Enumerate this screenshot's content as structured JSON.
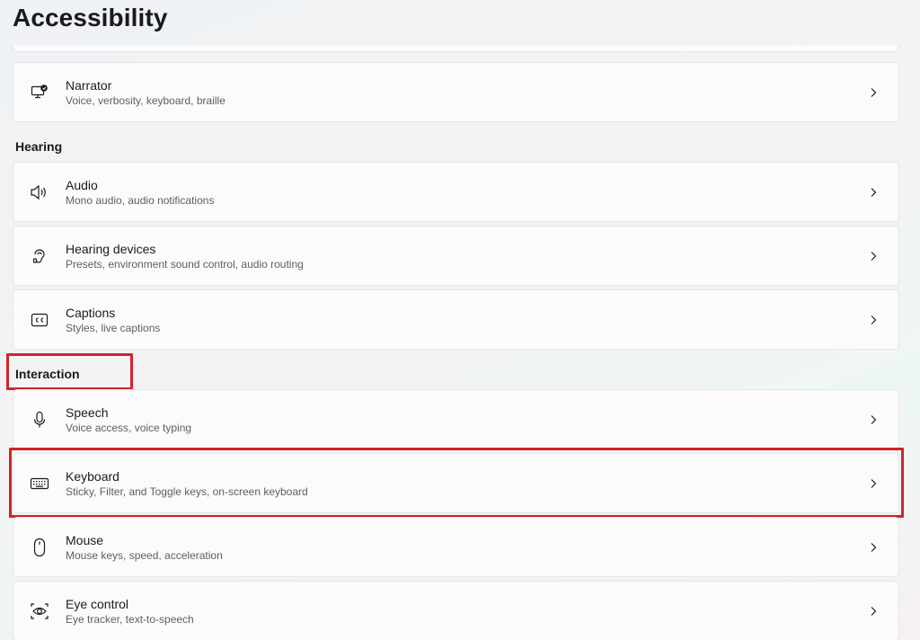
{
  "page": {
    "title": "Accessibility"
  },
  "sections": {
    "vision_tail": {
      "items": [
        {
          "label": "Narrator",
          "desc": "Voice, verbosity, keyboard, braille",
          "icon": "narrator-icon"
        }
      ]
    },
    "hearing": {
      "header": "Hearing",
      "items": [
        {
          "label": "Audio",
          "desc": "Mono audio, audio notifications",
          "icon": "speaker-icon"
        },
        {
          "label": "Hearing devices",
          "desc": "Presets, environment sound control, audio routing",
          "icon": "ear-icon"
        },
        {
          "label": "Captions",
          "desc": "Styles, live captions",
          "icon": "captions-icon"
        }
      ]
    },
    "interaction": {
      "header": "Interaction",
      "items": [
        {
          "label": "Speech",
          "desc": "Voice access, voice typing",
          "icon": "microphone-icon"
        },
        {
          "label": "Keyboard",
          "desc": "Sticky, Filter, and Toggle keys, on-screen keyboard",
          "icon": "keyboard-icon"
        },
        {
          "label": "Mouse",
          "desc": "Mouse keys, speed, acceleration",
          "icon": "mouse-icon"
        },
        {
          "label": "Eye control",
          "desc": "Eye tracker, text-to-speech",
          "icon": "eye-control-icon"
        }
      ]
    }
  },
  "annotations": {
    "highlight_color": "#d2232a"
  },
  "colors": {
    "card_bg": "#fbfbfb",
    "card_border": "#e5e5e5",
    "text_secondary": "#5f5f5f"
  }
}
